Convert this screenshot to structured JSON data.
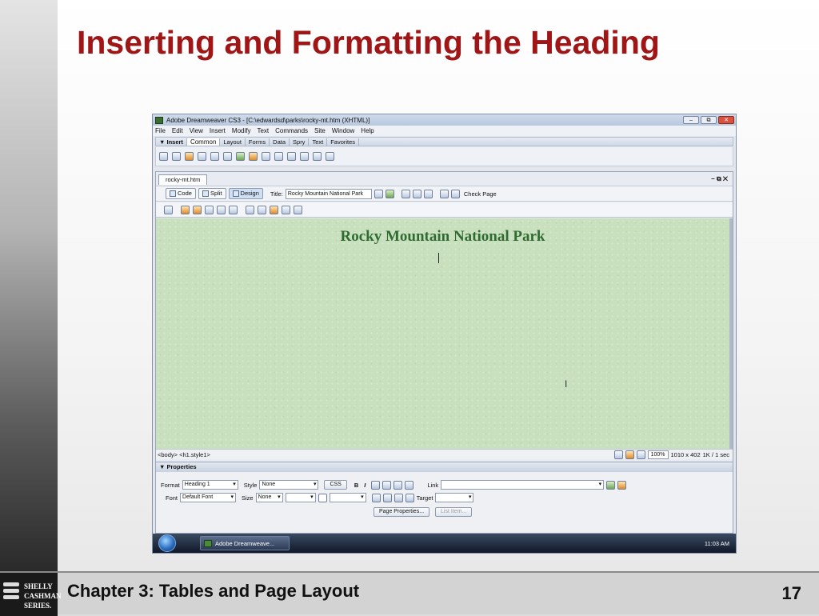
{
  "slide": {
    "title": "Inserting and Formatting the Heading",
    "footer": "Chapter 3: Tables and Page Layout",
    "page_number": "17",
    "logo_lines": [
      "SHELLY",
      "CASHMAN",
      "SERIES."
    ]
  },
  "window": {
    "title": "Adobe Dreamweaver CS3 - [C:\\edwardsd\\parks\\rocky-mt.htm (XHTML)]",
    "menu": [
      "File",
      "Edit",
      "View",
      "Insert",
      "Modify",
      "Text",
      "Commands",
      "Site",
      "Window",
      "Help"
    ]
  },
  "insert_bar": {
    "label": "▼ Insert",
    "tabs": [
      "Common",
      "Layout",
      "Forms",
      "Data",
      "Spry",
      "Text",
      "Favorites"
    ],
    "active": "Common"
  },
  "document": {
    "tab": "rocky-mt.htm",
    "window_controls": "– ⧉ ✕",
    "views": [
      "Code",
      "Split",
      "Design"
    ],
    "active_view": "Design",
    "title_label": "Title:",
    "title_value": "Rocky Mountain National Park",
    "check_page": "Check Page",
    "heading": "Rocky Mountain National Park"
  },
  "status_bar": {
    "tag_selector": "<body> <h1.style1>",
    "zoom": "100%",
    "size": "1010 x 402",
    "download": "1K / 1 sec"
  },
  "properties": {
    "header": "▼ Properties",
    "format_label": "Format",
    "format_value": "Heading 1",
    "style_label": "Style",
    "style_value": "None",
    "css_button": "CSS",
    "bold": "B",
    "italic": "I",
    "link_label": "Link",
    "font_label": "Font",
    "font_value": "Default Font",
    "size_label": "Size",
    "size_value": "None",
    "target_label": "Target",
    "page_properties_button": "Page Properties...",
    "list_item_button": "List Item..."
  },
  "taskbar": {
    "item": "Adobe Dreamweave...",
    "clock": "11:03 AM"
  },
  "colors": {
    "slide_title": "#a01616",
    "heading": "#2f6b33",
    "canvas": "#c9e0be"
  }
}
